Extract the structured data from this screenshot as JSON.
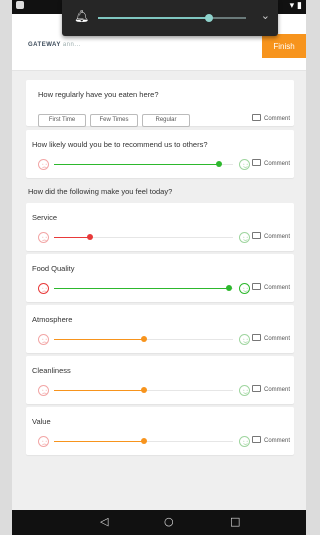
{
  "header": {
    "logo": "GATEWAY",
    "logo_sub": "ann...",
    "finish_label": "Finish"
  },
  "volume": {
    "level": 0.75
  },
  "frequency": {
    "question": "How regularly have you eaten here?",
    "options": [
      "First Time",
      "Few Times",
      "Regular"
    ]
  },
  "comment_label": "Comment",
  "recommend": {
    "question": "How likely would you be to recommend us to others?",
    "value": 0.92,
    "color": "#2db82d"
  },
  "section_heading": "How did the following make you feel today?",
  "ratings": [
    {
      "label": "Service",
      "value": 0.2,
      "color": "#e83a3a"
    },
    {
      "label": "Food Quality",
      "value": 0.98,
      "color": "#2db82d"
    },
    {
      "label": "Atmosphere",
      "value": 0.5,
      "color": "#f7941d"
    },
    {
      "label": "Cleanliness",
      "value": 0.5,
      "color": "#f7941d"
    },
    {
      "label": "Value",
      "value": 0.5,
      "color": "#f7941d"
    }
  ]
}
